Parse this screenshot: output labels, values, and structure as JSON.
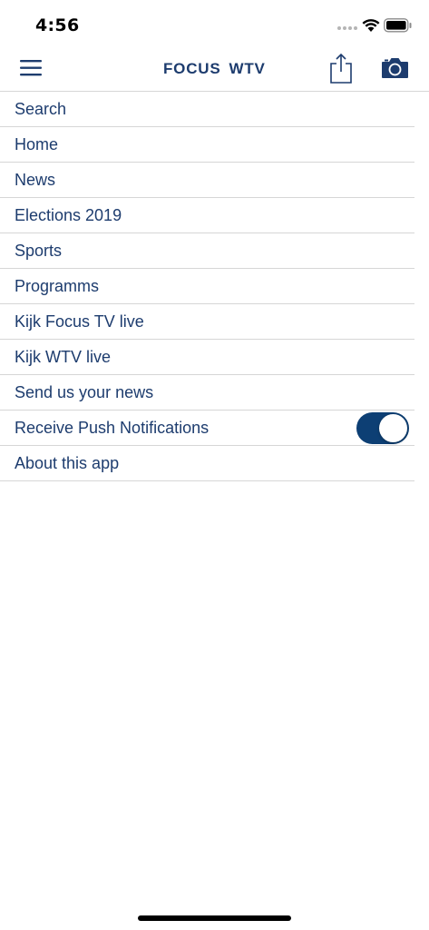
{
  "status_bar": {
    "time": "4:56",
    "icons": [
      "signal-dots-icon",
      "wifi-icon",
      "battery-icon"
    ]
  },
  "nav": {
    "menu_icon": "hamburger-menu-icon",
    "logo_left": "FOCUS",
    "logo_right": "WTV",
    "share_icon": "share-icon",
    "camera_icon": "camera-icon"
  },
  "menu": {
    "items": [
      {
        "label": "Search"
      },
      {
        "label": "Home"
      },
      {
        "label": "News"
      },
      {
        "label": "Elections 2019"
      },
      {
        "label": "Sports"
      },
      {
        "label": "Programms"
      },
      {
        "label": "Kijk Focus TV live"
      },
      {
        "label": "Kijk WTV live"
      },
      {
        "label": "Send us your news"
      },
      {
        "label": "Receive Push Notifications",
        "toggle": true
      },
      {
        "label": "About this app"
      }
    ]
  },
  "colors": {
    "brand": "#1d3c6e",
    "toggle_on": "#0d3f74",
    "divider": "#d6d6d6"
  }
}
